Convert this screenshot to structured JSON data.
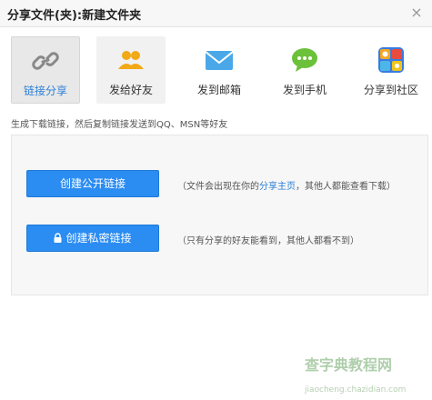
{
  "window": {
    "title": "分享文件(夹):新建文件夹",
    "close_glyph": "×"
  },
  "tabs": [
    {
      "label": "链接分享",
      "icon": "link-icon",
      "active": true
    },
    {
      "label": "发给好友",
      "icon": "friends-icon",
      "active": false
    },
    {
      "label": "发到邮箱",
      "icon": "mail-icon",
      "active": false
    },
    {
      "label": "发到手机",
      "icon": "phone-chat-icon",
      "active": false
    },
    {
      "label": "分享到社区",
      "icon": "community-icon",
      "active": false
    }
  ],
  "description": "生成下载链接，然后复制链接发送到QQ、MSN等好友",
  "public_link": {
    "button_label": "创建公开链接",
    "note_prefix": "（文件会出现在你的",
    "note_link": "分享主页",
    "note_suffix": "，其他人都能查看下载）"
  },
  "private_link": {
    "button_label": "创建私密链接",
    "note": "（只有分享的好友能看到，其他人都看不到）"
  },
  "watermark": {
    "text": "查字典教程网",
    "url": "jiaocheng.chazidian.com"
  },
  "colors": {
    "accent": "#2b8cf2",
    "link": "#2c7fd6",
    "active_tab_bg": "#e8e8e8"
  }
}
